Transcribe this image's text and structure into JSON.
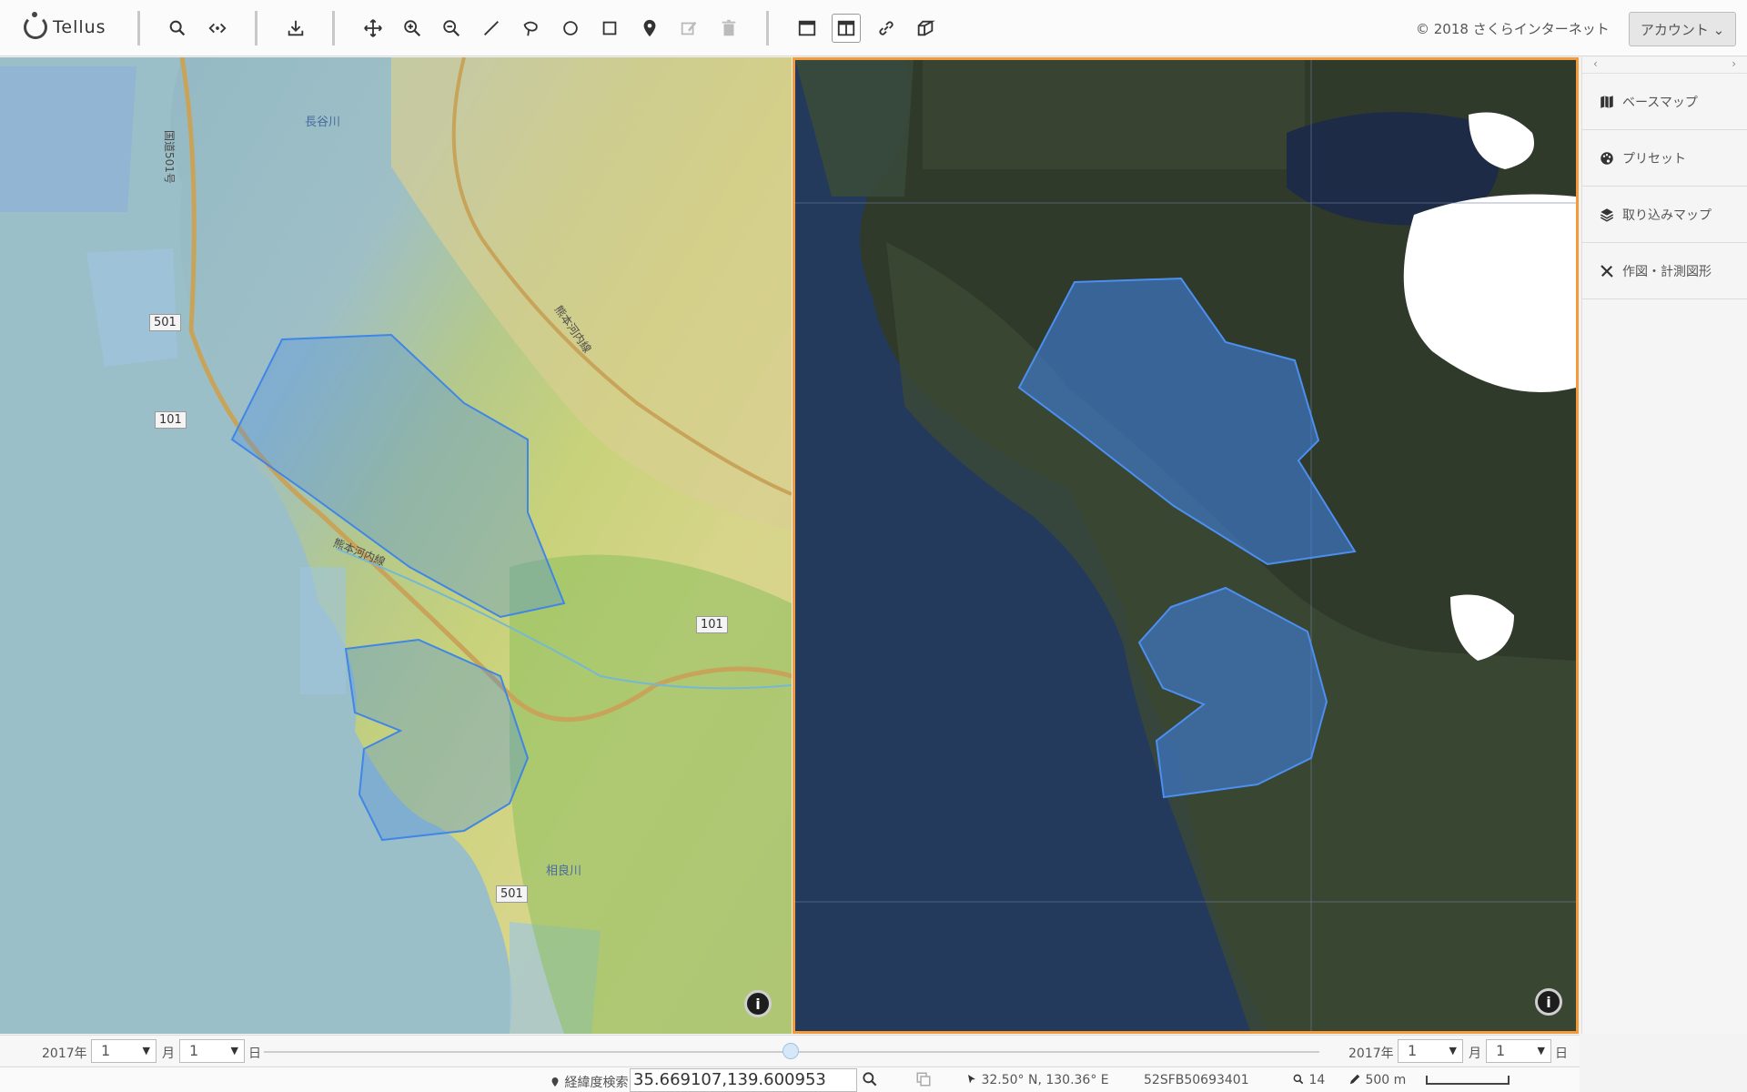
{
  "app": {
    "name": "Tellus",
    "copyright": "© 2018 さくらインターネット",
    "account": "アカウント ⌄"
  },
  "toolbar": {
    "groups": [
      [
        "search-icon",
        "share-icon"
      ],
      [
        "download-icon"
      ],
      [
        "move-icon",
        "zoom-in-icon",
        "zoom-out-icon",
        "line-icon",
        "lasso-icon",
        "circle-icon",
        "rectangle-icon",
        "pin-icon",
        "edit-icon",
        "trash-icon"
      ],
      [
        "single-view-icon",
        "split-view-icon",
        "link-icon",
        "3d-icon"
      ]
    ],
    "active": "split-view-icon"
  },
  "sidebar": {
    "nav_prev": "‹",
    "nav_next": "›",
    "items": [
      {
        "label": "ベースマップ",
        "icon": "map-icon"
      },
      {
        "label": "プリセット",
        "icon": "palette-icon"
      },
      {
        "label": "取り込みマップ",
        "icon": "layers-icon"
      },
      {
        "label": "作図・計測図形",
        "icon": "ruler-pencil-icon"
      }
    ]
  },
  "map_left": {
    "labels": [
      {
        "text": "国道501号"
      },
      {
        "text": "501"
      },
      {
        "text": "101"
      },
      {
        "text": "長谷川"
      },
      {
        "text": "熊本河内線"
      },
      {
        "text": "101"
      },
      {
        "text": "501"
      },
      {
        "text": "相良川"
      },
      {
        "text": "熊本河内線"
      }
    ]
  },
  "timebar": {
    "left": {
      "year": "2017年",
      "month_value": "1",
      "month_unit": "月",
      "day_value": "1",
      "day_unit": "日"
    },
    "right": {
      "year": "2017年",
      "month_value": "1",
      "month_unit": "月",
      "day_value": "1",
      "day_unit": "日"
    },
    "slider_value": 0.5
  },
  "status": {
    "coord_search_label": "経緯度検索",
    "coord_value": "35.669107,139.600953",
    "cursor_coords": "32.50° N, 130.36° E",
    "scene_id": "52SFB50693401",
    "zoom": "14",
    "scale": "500 m"
  },
  "info_label": "i"
}
